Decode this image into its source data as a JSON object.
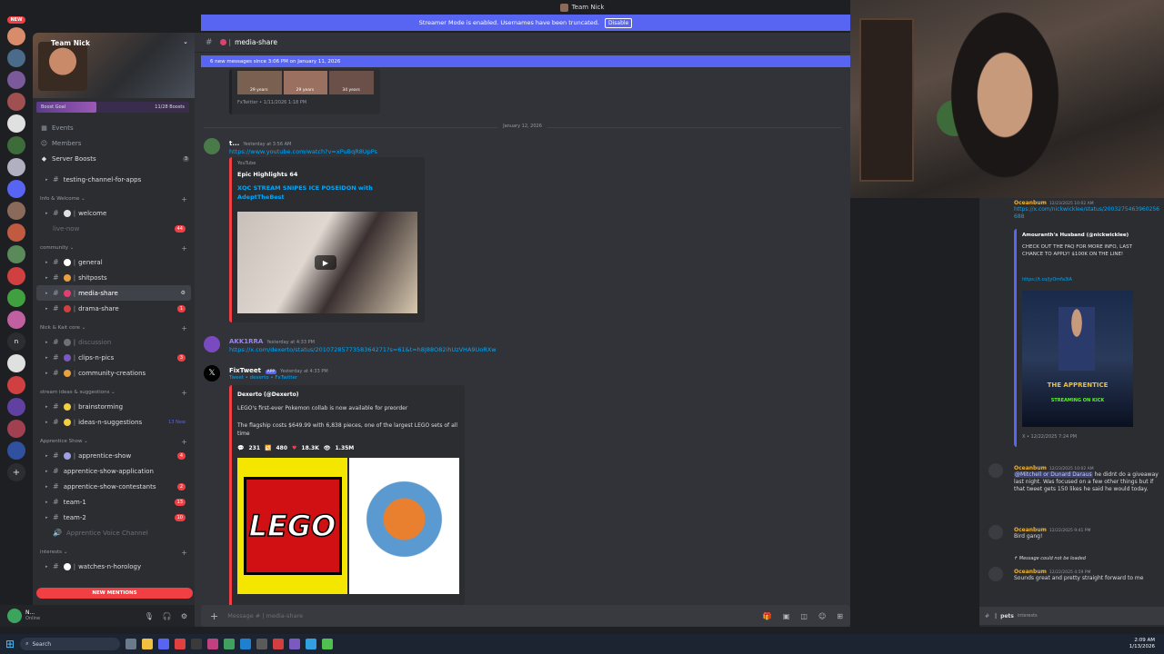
{
  "window": {
    "title": "Team Nick"
  },
  "streamer_banner": {
    "text": "Streamer Mode is enabled. Usernames have been truncated.",
    "button": "Disable"
  },
  "rail": {
    "new_label": "NEW"
  },
  "sidebar": {
    "server_name": "Team Nick",
    "boost": {
      "label": "Boost Goal",
      "progress": "11/28 Boosts",
      "fraction": 0.39
    },
    "top_items": [
      {
        "label": "Events",
        "icon": "calendar-icon"
      },
      {
        "label": "Members",
        "icon": "members-icon"
      },
      {
        "label": "Server Boosts",
        "icon": "boost-icon",
        "count": "3"
      }
    ],
    "channels_top": [
      {
        "name": "testing-channel-for-apps"
      }
    ],
    "categories": [
      {
        "name": "Info & Welcome",
        "channels": [
          {
            "name": "welcome",
            "muted": false
          },
          {
            "name": "live-now",
            "muted": true,
            "badge": "44"
          }
        ]
      },
      {
        "name": "community",
        "channels": [
          {
            "name": "general"
          },
          {
            "name": "shitposts"
          },
          {
            "name": "media-share",
            "active": true
          },
          {
            "name": "drama-share",
            "badge": "1"
          }
        ]
      },
      {
        "name": "Nick & Kait core",
        "channels": [
          {
            "name": "discussion",
            "muted": true
          },
          {
            "name": "clips-n-pics",
            "badge": "3"
          },
          {
            "name": "community-creations"
          }
        ]
      },
      {
        "name": "stream ideas & suggestions",
        "channels": [
          {
            "name": "brainstorming"
          },
          {
            "name": "ideas-n-suggestions",
            "new": "13 New"
          }
        ]
      },
      {
        "name": "Apprentice Show",
        "channels": [
          {
            "name": "apprentice-show",
            "badge": "4"
          },
          {
            "name": "apprentice-show-application"
          },
          {
            "name": "apprentice-show-contestants",
            "badge": "2"
          },
          {
            "name": "team-1",
            "badge": "13"
          },
          {
            "name": "team-2",
            "badge": "10"
          },
          {
            "name": "Apprentice Voice Channel",
            "voice": true
          }
        ]
      },
      {
        "name": "interests",
        "channels": [
          {
            "name": "watches-n-horology"
          }
        ]
      }
    ],
    "new_mentions": "NEW MENTIONS",
    "user": {
      "name": "N...",
      "status": "Online"
    }
  },
  "chat": {
    "channel": "media-share",
    "new_messages": "6 new messages since 3:06 PM on January 11, 2026",
    "fx_footer_1": "FxTwitter • 1/11/2026 1:18 PM",
    "thumb_labels": [
      "29 years",
      "29 years",
      "34 years"
    ],
    "date_divider": "January 12, 2026",
    "msg1": {
      "user": "t...",
      "time": "Yesterday at 3:56 AM",
      "link": "https://www.youtube.com/watch?v=xPuBqR8UpPs",
      "provider": "YouTube",
      "author": "Epic Highlights 64",
      "title": "XQC STREAM SNIPES ICE POSEIDON with AdeptTheBest"
    },
    "msg2": {
      "user": "AKK1RRA",
      "time": "Yesterday at 4:33 PM",
      "link": "https://x.com/dexerto/status/2010728577358364271?s=61&t=h8J88O82ihUzVHA9UoRXw"
    },
    "msg3": {
      "user": "FixTweet",
      "tag": "APP",
      "time": "Yesterday at 4:33 PM",
      "sub": "Tweet • dexerto • FxTwitter",
      "author": "Dexerto (@Dexerto)",
      "line1": "LEGO's first-ever Pokemon collab is now available for preorder",
      "line2": "The flagship costs $649.99 with 6,838 pieces, one of the largest LEGO sets of all time",
      "stats": {
        "replies": "231",
        "retweets": "480",
        "likes": "18.3K",
        "views": "1.35M"
      },
      "lego_logo": "LEGO"
    },
    "input_placeholder": "Message #  |  media-share"
  },
  "thread": {
    "m1": {
      "user": "Oceanbum",
      "time": "12/23/2025 10:02 AM",
      "link": "https://x.com/nickwicklee/status/2003275463960256688",
      "embed_author": "Amouranth's Husband (@nickwicklee)",
      "embed_text": "CHECK OUT THE FAQ FOR MORE INFO, LAST CHANCE TO APPLY! $100K ON THE LINE!",
      "embed_link": "https://t.co/jyOmfa3iA",
      "poster_title": "THE APPRENTICE",
      "poster_sub": "STREAMING ON KICK",
      "embed_footer": "X • 12/22/2025 7:24 PM"
    },
    "m2": {
      "user": "Oceanbum",
      "time": "12/23/2025 10:02 AM",
      "mention": "@Mitchell or Dunard Daraus",
      "text": "he didnt do a giveaway last night. Was focused on a few other things but if that tweet gets 150 likes he said he would today."
    },
    "m3": {
      "user": "Oceanbum",
      "time": "12/22/2025 9:41 PM",
      "text": "Bird gang!"
    },
    "could_not_load": "Message could not be loaded",
    "m4": {
      "user": "Oceanbum",
      "time": "12/22/2025 4:59 PM",
      "text": "Sounds great and pretty straight forward to me"
    },
    "channel": "pets",
    "channel_sub": "interests"
  },
  "taskbar": {
    "search": "Search",
    "time": "2:09 AM",
    "date": "1/13/2026"
  }
}
